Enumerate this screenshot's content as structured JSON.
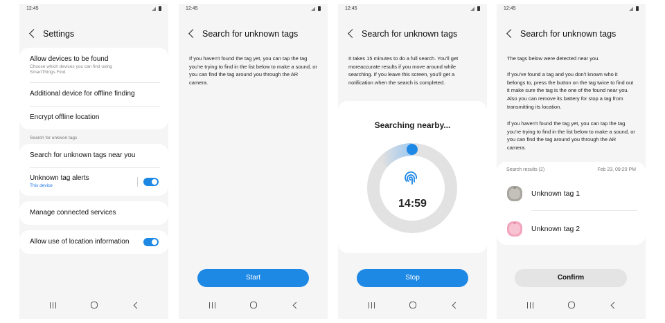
{
  "status": {
    "time": "12:45"
  },
  "screen1": {
    "title": "Settings",
    "allow_found": {
      "title": "Allow devices to be found",
      "subtitle": "Choose which devices you can find using SmartThings Find."
    },
    "additional": "Additional device for offline finding",
    "encrypt": "Encrypt offline location",
    "section_label": "Search for unkwon tags",
    "search_near": "Search for unknown tags near you",
    "alerts": {
      "title": "Unknown tag alerts",
      "subtitle": "This device",
      "on": true
    },
    "manage": "Manage connected services",
    "location": {
      "title": "Allow use of location information",
      "on": true
    }
  },
  "screen2": {
    "title": "Search for unknown tags",
    "body": "If you haven't found the tag yet, you can tap the tag you're trying to find in the list below to make a sound, or you can find the tag around you through the AR camera.",
    "button": "Start"
  },
  "screen3": {
    "title": "Search for unknown tags",
    "body": "It takes 15 minutes to do a full search. You'll get moreaccurate results if you move around while searching. If you leave this screen, you'll get a notification when the search is completed.",
    "searching": "Searching nearby...",
    "timer": "14:59",
    "button": "Stop"
  },
  "screen4": {
    "title": "Search for unknown tags",
    "p1": "The tags below were detected near you.",
    "p2": "If you've found a tag and you don't known who it belongs to, press the button on the tag twice to find out it make sure the tag  is the one of the found near you. Also you can remove its battery for stop a tag from transmitting its location.",
    "p3": "If you haven't found the tag yet, you can tap the tag you're trying to find in the list below to make a sound, or you can find the tag around you through the AR camera.",
    "results_label": "Search results (2)",
    "results_date": "Feb 23, 09:20 PM",
    "tags": [
      {
        "name": "Unknown tag 1",
        "color": "#a9a6a0"
      },
      {
        "name": "Unknown tag 2",
        "color": "#f2a6bd"
      }
    ],
    "button": "Confirm"
  },
  "colors": {
    "accent": "#1e88e5",
    "background": "#f5f5f5",
    "card": "#ffffff"
  },
  "icons": [
    "back-icon",
    "fingerprint-scan-icon",
    "recents-nav-icon",
    "home-nav-icon",
    "back-nav-icon",
    "signal-icon",
    "battery-icon"
  ]
}
